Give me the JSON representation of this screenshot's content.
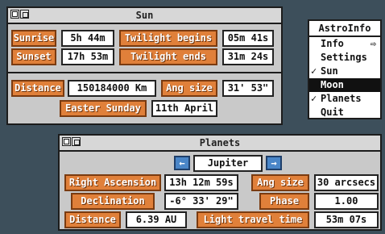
{
  "sun_window": {
    "title": "Sun",
    "sunrise_label": "Sunrise",
    "sunrise_value": "5h 44m",
    "twilight_begins_label": "Twilight begins",
    "twilight_begins_value": "05m 41s",
    "sunset_label": "Sunset",
    "sunset_value": "17h 53m",
    "twilight_ends_label": "Twilight ends",
    "twilight_ends_value": "31m 24s",
    "distance_label": "Distance",
    "distance_value": "150184000 Km",
    "ang_size_label": "Ang size",
    "ang_size_value": "31' 53\"",
    "easter_label": "Easter Sunday",
    "easter_value": "11th April"
  },
  "planets_window": {
    "title": "Planets",
    "prev_glyph": "←",
    "next_glyph": "→",
    "planet": "Jupiter",
    "ra_label": "Right Ascension",
    "ra_value": "13h 12m 59s",
    "ang_size_label": "Ang size",
    "ang_size_value": "30 arcsecs",
    "dec_label": "Declination",
    "dec_value": "-6° 33' 29\"",
    "phase_label": "Phase",
    "phase_value": "1.00",
    "distance_label": "Distance",
    "distance_value": "6.39 AU",
    "light_label": "Light travel time",
    "light_value": "53m 07s"
  },
  "menu": {
    "title": "AstroInfo",
    "items": [
      {
        "label": "Info",
        "tick": "",
        "submenu": "⇨"
      },
      {
        "label": "Settings",
        "tick": "",
        "submenu": ""
      },
      {
        "label": "Sun",
        "tick": "✓",
        "submenu": ""
      },
      {
        "label": "Moon",
        "tick": "",
        "submenu": "",
        "highlighted": true
      },
      {
        "label": "Planets",
        "tick": "✓",
        "submenu": ""
      },
      {
        "label": "Quit",
        "tick": "",
        "submenu": ""
      }
    ]
  }
}
